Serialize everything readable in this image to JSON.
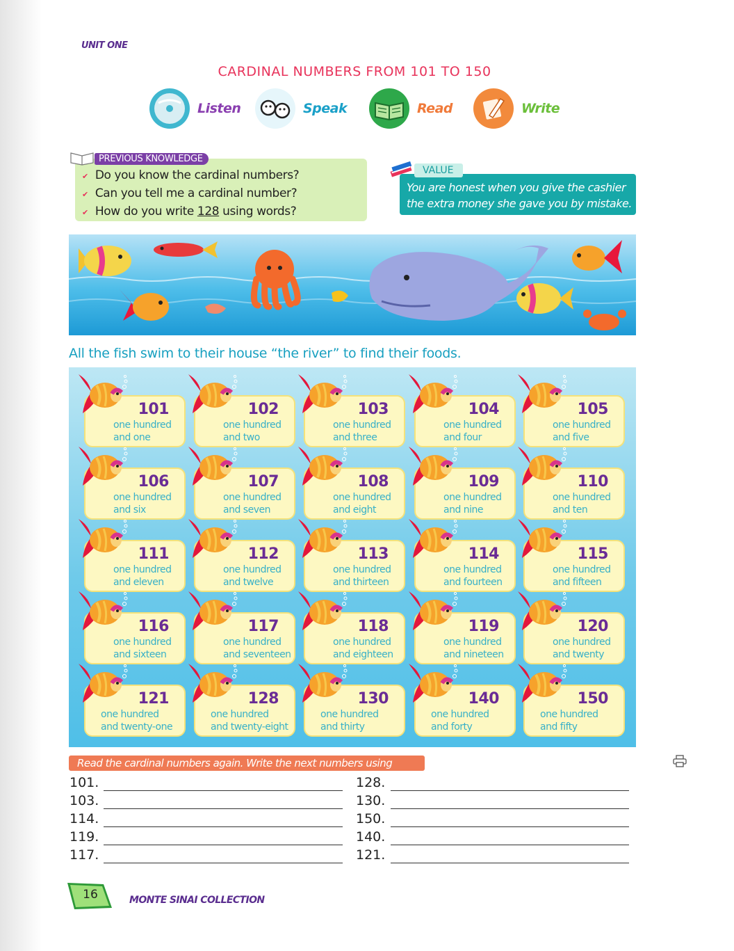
{
  "header": {
    "unit": "UNIT ONE",
    "title": "CARDINAL NUMBERS FROM 101 TO 150"
  },
  "skills": [
    {
      "label": "Listen",
      "icon": "cd-icon",
      "color": "#8a3fb0"
    },
    {
      "label": "Speak",
      "icon": "speech-faces-icon",
      "color": "#1aa0c8"
    },
    {
      "label": "Read",
      "icon": "book-icon",
      "color": "#f07a3a"
    },
    {
      "label": "Write",
      "icon": "pencil-icon",
      "color": "#6bbf3a"
    }
  ],
  "previous_knowledge": {
    "tag": "PREVIOUS KNOWLEDGE",
    "items": [
      "Do you know the cardinal numbers?",
      "Can you tell me a cardinal number?"
    ],
    "item3_before": "How do you write ",
    "item3_number": "128",
    "item3_after": " using words?"
  },
  "value": {
    "tag": "VALUE",
    "line1": "You are honest when you give the cashier",
    "line2": "the extra money she gave you by mistake."
  },
  "instruction": "All the fish swim to their house “the river” to find their foods.",
  "cards": [
    {
      "num": "101",
      "w1": "one hundred",
      "w2": "and one"
    },
    {
      "num": "102",
      "w1": "one hundred",
      "w2": "and two"
    },
    {
      "num": "103",
      "w1": "one hundred",
      "w2": "and three"
    },
    {
      "num": "104",
      "w1": "one hundred",
      "w2": "and four"
    },
    {
      "num": "105",
      "w1": "one hundred",
      "w2": "and five"
    },
    {
      "num": "106",
      "w1": "one hundred",
      "w2": "and six"
    },
    {
      "num": "107",
      "w1": "one hundred",
      "w2": "and seven"
    },
    {
      "num": "108",
      "w1": "one hundred",
      "w2": "and eight"
    },
    {
      "num": "109",
      "w1": "one hundred",
      "w2": "and nine"
    },
    {
      "num": "110",
      "w1": "one hundred",
      "w2": "and ten"
    },
    {
      "num": "111",
      "w1": "one hundred",
      "w2": "and eleven"
    },
    {
      "num": "112",
      "w1": "one hundred",
      "w2": "and twelve"
    },
    {
      "num": "113",
      "w1": "one hundred",
      "w2": "and thirteen"
    },
    {
      "num": "114",
      "w1": "one hundred",
      "w2": "and fourteen"
    },
    {
      "num": "115",
      "w1": "one hundred",
      "w2": "and fifteen"
    },
    {
      "num": "116",
      "w1": "one hundred",
      "w2": "and sixteen"
    },
    {
      "num": "117",
      "w1": "one hundred",
      "w2": "and seventeen"
    },
    {
      "num": "118",
      "w1": "one hundred",
      "w2": "and eighteen"
    },
    {
      "num": "119",
      "w1": "one hundred",
      "w2": "and nineteen"
    },
    {
      "num": "120",
      "w1": "one hundred",
      "w2": "and twenty"
    },
    {
      "num": "121",
      "w1": "one hundred",
      "w2": "and twenty-one"
    },
    {
      "num": "128",
      "w1": "one hundred",
      "w2": "and twenty-eight"
    },
    {
      "num": "130",
      "w1": "one hundred",
      "w2": "and thirty"
    },
    {
      "num": "140",
      "w1": "one hundred",
      "w2": "and forty"
    },
    {
      "num": "150",
      "w1": "one hundred",
      "w2": "and fifty"
    }
  ],
  "exercise": {
    "instruction": "Read the cardinal numbers again. Write the next numbers using words.",
    "left": [
      "101.",
      "103.",
      "114.",
      "119.",
      "117."
    ],
    "right": [
      "128.",
      "130.",
      "150.",
      "140.",
      "121."
    ]
  },
  "footer": {
    "page": "16",
    "collection": "MONTE SINAI COLLECTION"
  }
}
